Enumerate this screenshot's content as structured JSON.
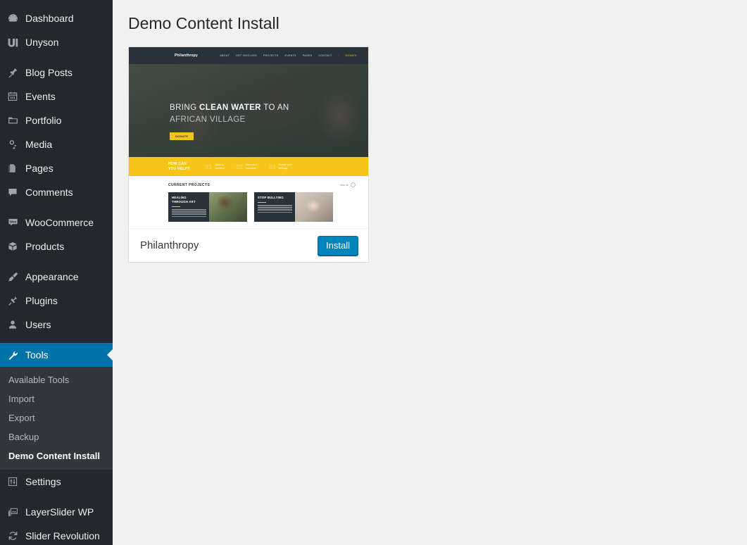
{
  "sidebar": {
    "groups": [
      {
        "items": [
          {
            "label": "Dashboard",
            "icon": "dashboard-icon",
            "name": "sidebar-item-dashboard"
          },
          {
            "label": "Unyson",
            "icon": "unyson-icon",
            "name": "sidebar-item-unyson"
          }
        ]
      },
      {
        "items": [
          {
            "label": "Blog Posts",
            "icon": "pin-icon",
            "name": "sidebar-item-blog-posts"
          },
          {
            "label": "Events",
            "icon": "calendar-icon",
            "name": "sidebar-item-events"
          },
          {
            "label": "Portfolio",
            "icon": "portfolio-icon",
            "name": "sidebar-item-portfolio"
          },
          {
            "label": "Media",
            "icon": "media-icon",
            "name": "sidebar-item-media"
          },
          {
            "label": "Pages",
            "icon": "pages-icon",
            "name": "sidebar-item-pages"
          },
          {
            "label": "Comments",
            "icon": "comment-icon",
            "name": "sidebar-item-comments"
          }
        ]
      },
      {
        "items": [
          {
            "label": "WooCommerce",
            "icon": "woocommerce-icon",
            "name": "sidebar-item-woocommerce"
          },
          {
            "label": "Products",
            "icon": "products-box-icon",
            "name": "sidebar-item-products"
          }
        ]
      },
      {
        "items": [
          {
            "label": "Appearance",
            "icon": "paintbrush-icon",
            "name": "sidebar-item-appearance"
          },
          {
            "label": "Plugins",
            "icon": "plugin-icon",
            "name": "sidebar-item-plugins"
          },
          {
            "label": "Users",
            "icon": "user-icon",
            "name": "sidebar-item-users"
          }
        ]
      }
    ],
    "tools": {
      "label": "Tools",
      "icon": "wrench-icon",
      "submenu": [
        {
          "label": "Available Tools",
          "current": false
        },
        {
          "label": "Import",
          "current": false
        },
        {
          "label": "Export",
          "current": false
        },
        {
          "label": "Backup",
          "current": false
        },
        {
          "label": "Demo Content Install",
          "current": true
        }
      ]
    },
    "after_tools": [
      {
        "items": [
          {
            "label": "Settings",
            "icon": "settings-sliders-icon",
            "name": "sidebar-item-settings"
          }
        ]
      },
      {
        "items": [
          {
            "label": "LayerSlider WP",
            "icon": "images-stack-icon",
            "name": "sidebar-item-layerslider"
          },
          {
            "label": "Slider Revolution",
            "icon": "refresh-circle-icon",
            "name": "sidebar-item-slider-revolution"
          }
        ]
      }
    ]
  },
  "main": {
    "page_title": "Demo Content Install",
    "theme": {
      "name": "Philanthropy",
      "install_label": "Install"
    }
  },
  "theme_preview": {
    "logo": "Philanthropy",
    "nav": [
      "ABOUT",
      "GET INVOLVED",
      "PROJECTS",
      "EVENTS",
      "PAGES",
      "CONTACT"
    ],
    "donate": "DONATE",
    "hero": {
      "line1_pre": "BRING ",
      "line1_strong": "CLEAN WATER",
      "line1_post": " TO AN",
      "line2": "AFRICAN VILLAGE",
      "cta": "DONATE"
    },
    "help": {
      "title_line1": "HOW CAN",
      "title_line2": "YOU HELP?",
      "steps": [
        {
          "num": "01",
          "line1": "Make a",
          "line2": "donation"
        },
        {
          "num": "02",
          "line1": "Become a",
          "line2": "volunteer"
        },
        {
          "num": "03",
          "line1": "Donate your",
          "line2": "birthday"
        }
      ]
    },
    "projects": {
      "title": "CURRENT PROJECTS",
      "view_all": "View all",
      "cards": [
        {
          "title_line1": "HEALING",
          "title_line2": "THROUGH ART"
        },
        {
          "title_line1": "STOP BULLYING",
          "title_line2": ""
        }
      ]
    }
  },
  "colors": {
    "admin_bg": "#23282d",
    "submenu_bg": "#32373c",
    "active_blue": "#0073aa",
    "button_blue": "#0085ba",
    "content_bg": "#f1f1f1",
    "theme_yellow": "#f5c518",
    "theme_dark": "#27323a"
  }
}
